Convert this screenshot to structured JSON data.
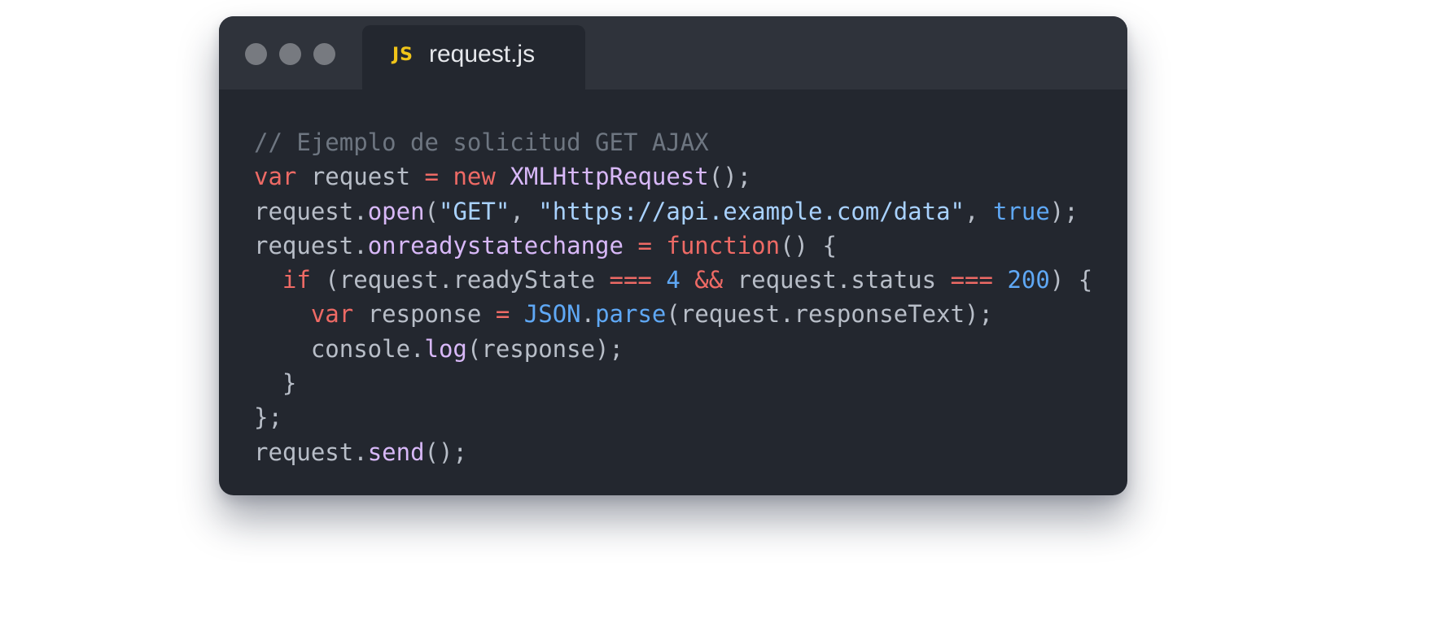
{
  "window": {
    "tab": {
      "badge": "JS",
      "filename": "request.js"
    }
  },
  "code": {
    "lines": [
      [
        {
          "text": "// Ejemplo de solicitud GET AJAX",
          "kind": "comment"
        }
      ],
      [
        {
          "text": "var",
          "kind": "keyword"
        },
        {
          "text": " request ",
          "kind": "plain"
        },
        {
          "text": "=",
          "kind": "keyword"
        },
        {
          "text": " ",
          "kind": "plain"
        },
        {
          "text": "new",
          "kind": "keyword"
        },
        {
          "text": " ",
          "kind": "plain"
        },
        {
          "text": "XMLHttpRequest",
          "kind": "class"
        },
        {
          "text": "();",
          "kind": "plain"
        }
      ],
      [
        {
          "text": "request.",
          "kind": "plain"
        },
        {
          "text": "open",
          "kind": "method"
        },
        {
          "text": "(",
          "kind": "plain"
        },
        {
          "text": "\"GET\"",
          "kind": "string"
        },
        {
          "text": ", ",
          "kind": "plain"
        },
        {
          "text": "\"https://api.example.com/data\"",
          "kind": "string"
        },
        {
          "text": ", ",
          "kind": "plain"
        },
        {
          "text": "true",
          "kind": "const"
        },
        {
          "text": ");",
          "kind": "plain"
        }
      ],
      [
        {
          "text": "request.",
          "kind": "plain"
        },
        {
          "text": "onreadystatechange",
          "kind": "method"
        },
        {
          "text": " ",
          "kind": "plain"
        },
        {
          "text": "=",
          "kind": "keyword"
        },
        {
          "text": " ",
          "kind": "plain"
        },
        {
          "text": "function",
          "kind": "keyword"
        },
        {
          "text": "() {",
          "kind": "plain"
        }
      ],
      [
        {
          "text": "  ",
          "kind": "plain"
        },
        {
          "text": "if",
          "kind": "keyword"
        },
        {
          "text": " (request.readyState ",
          "kind": "plain"
        },
        {
          "text": "===",
          "kind": "keyword"
        },
        {
          "text": " ",
          "kind": "plain"
        },
        {
          "text": "4",
          "kind": "number"
        },
        {
          "text": " ",
          "kind": "plain"
        },
        {
          "text": "&&",
          "kind": "keyword"
        },
        {
          "text": " request.status ",
          "kind": "plain"
        },
        {
          "text": "===",
          "kind": "keyword"
        },
        {
          "text": " ",
          "kind": "plain"
        },
        {
          "text": "200",
          "kind": "number"
        },
        {
          "text": ") {",
          "kind": "plain"
        }
      ],
      [
        {
          "text": "    ",
          "kind": "plain"
        },
        {
          "text": "var",
          "kind": "keyword"
        },
        {
          "text": " response ",
          "kind": "plain"
        },
        {
          "text": "=",
          "kind": "keyword"
        },
        {
          "text": " ",
          "kind": "plain"
        },
        {
          "text": "JSON",
          "kind": "const"
        },
        {
          "text": ".",
          "kind": "plain"
        },
        {
          "text": "parse",
          "kind": "const"
        },
        {
          "text": "(request.responseText);",
          "kind": "plain"
        }
      ],
      [
        {
          "text": "    console.",
          "kind": "plain"
        },
        {
          "text": "log",
          "kind": "method"
        },
        {
          "text": "(response);",
          "kind": "plain"
        }
      ],
      [
        {
          "text": "  }",
          "kind": "plain"
        }
      ],
      [
        {
          "text": "};",
          "kind": "plain"
        }
      ],
      [
        {
          "text": "request.",
          "kind": "plain"
        },
        {
          "text": "send",
          "kind": "method"
        },
        {
          "text": "();",
          "kind": "plain"
        }
      ]
    ]
  }
}
